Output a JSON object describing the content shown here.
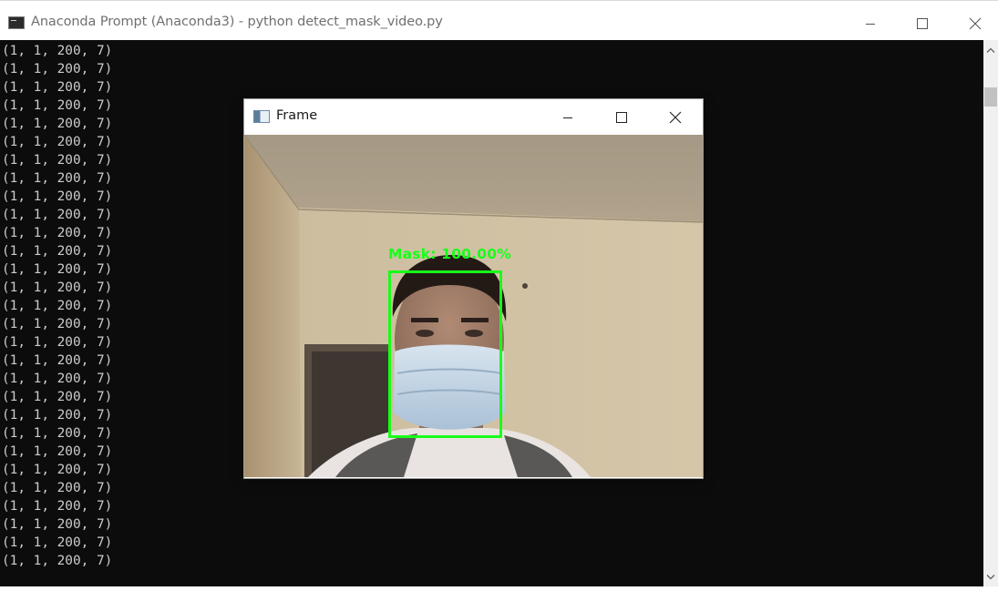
{
  "console": {
    "title": "Anaconda Prompt (Anaconda3) - python  detect_mask_video.py",
    "icon": "console-icon",
    "output_lines": [
      "(1, 1, 200, 7)",
      "(1, 1, 200, 7)",
      "(1, 1, 200, 7)",
      "(1, 1, 200, 7)",
      "(1, 1, 200, 7)",
      "(1, 1, 200, 7)",
      "(1, 1, 200, 7)",
      "(1, 1, 200, 7)",
      "(1, 1, 200, 7)",
      "(1, 1, 200, 7)",
      "(1, 1, 200, 7)",
      "(1, 1, 200, 7)",
      "(1, 1, 200, 7)",
      "(1, 1, 200, 7)",
      "(1, 1, 200, 7)",
      "(1, 1, 200, 7)",
      "(1, 1, 200, 7)",
      "(1, 1, 200, 7)",
      "(1, 1, 200, 7)",
      "(1, 1, 200, 7)",
      "(1, 1, 200, 7)",
      "(1, 1, 200, 7)",
      "(1, 1, 200, 7)",
      "(1, 1, 200, 7)",
      "(1, 1, 200, 7)",
      "(1, 1, 200, 7)",
      "(1, 1, 200, 7)",
      "(1, 1, 200, 7)",
      "(1, 1, 200, 7)"
    ],
    "colors": {
      "background": "#0c0c0c",
      "text": "#cccccc"
    }
  },
  "frame_window": {
    "title": "Frame",
    "icon": "frame-app-icon",
    "detection": {
      "label": "Mask: 100.00%",
      "color": "#18ff18"
    }
  }
}
